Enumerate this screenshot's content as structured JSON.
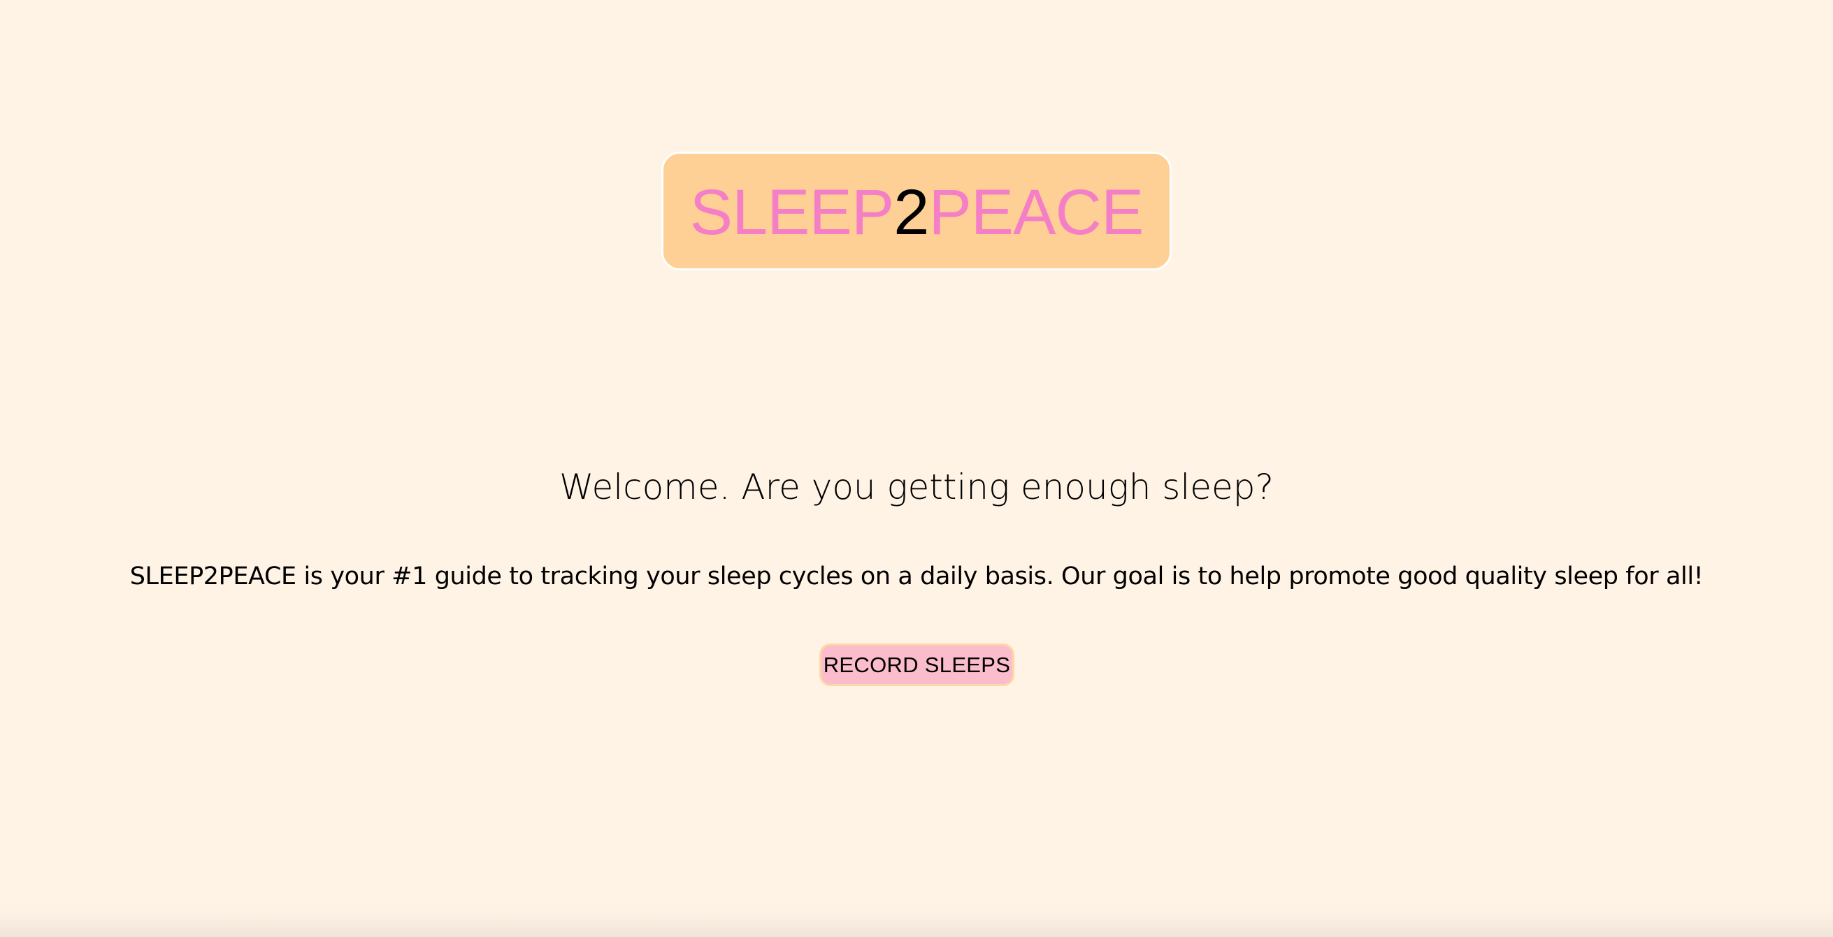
{
  "logo": {
    "part1": "SLEEP",
    "part2": "2",
    "part3": "PEACE",
    "colors": {
      "accent": "#f47fc6",
      "digit": "#000000",
      "box_background": "#ffd096"
    }
  },
  "main": {
    "heading": "Welcome. Are you getting enough sleep?",
    "description": "SLEEP2PEACE is your #1 guide to tracking your sleep cycles on a daily basis. Our goal is to help promote good quality sleep for all!",
    "button_label": "RECORD SLEEPS"
  },
  "colors": {
    "page_background": "#fff3e6",
    "button_background": "#fbbccb",
    "button_border": "#ffd7a6"
  }
}
